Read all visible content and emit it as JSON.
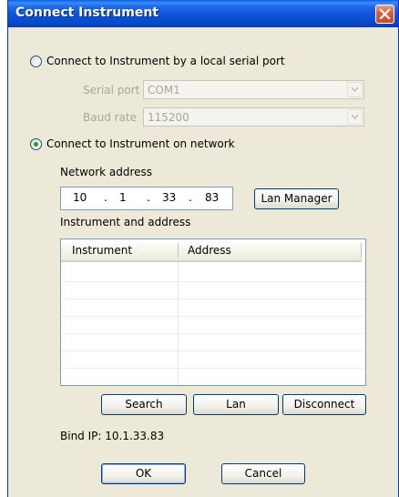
{
  "window": {
    "title": "Connect Instrument"
  },
  "serial": {
    "option_label": "Connect to Instrument by a local serial port",
    "selected": false,
    "port_label": "Serial port",
    "port_value": "COM1",
    "baud_label": "Baud rate",
    "baud_value": "115200"
  },
  "network": {
    "option_label": "Connect to Instrument on network",
    "selected": true,
    "address_label": "Network address",
    "ip": [
      "10",
      "1",
      "33",
      "83"
    ],
    "ip_sep": ".",
    "lan_manager_label": "Lan Manager",
    "list_label": "Instrument and address",
    "columns": [
      "Instrument",
      "Address"
    ],
    "rows": []
  },
  "actions": {
    "search_label": "Search",
    "lan_label": "Lan",
    "disconnect_label": "Disconnect"
  },
  "bind_ip_text": "Bind IP: 10.1.33.83",
  "footer": {
    "ok_label": "OK",
    "cancel_label": "Cancel"
  },
  "colors": {
    "titlebar": "#0b53d8",
    "dialog_bg": "#ece9d8",
    "radio_dot": "#21a121",
    "close": "#c84a28"
  }
}
